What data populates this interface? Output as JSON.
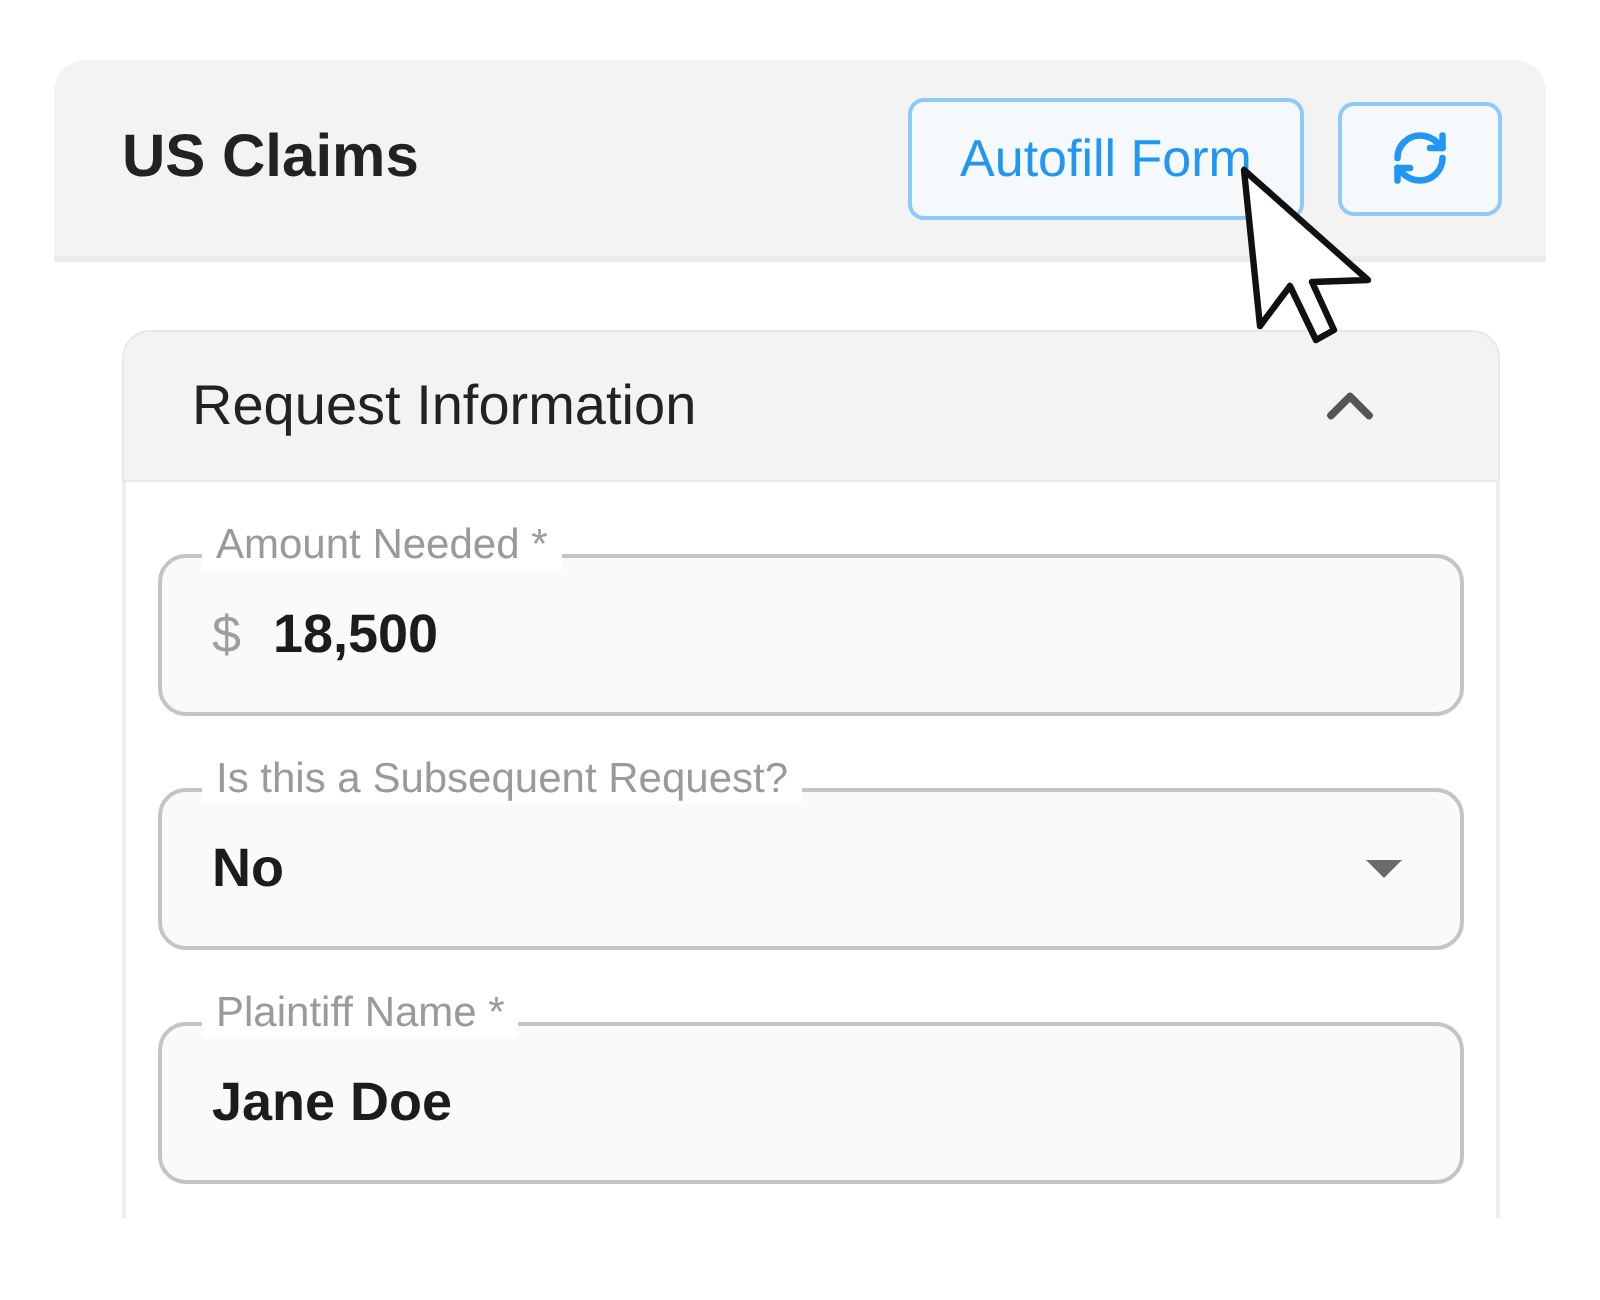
{
  "header": {
    "title": "US Claims",
    "autofill_button": "Autofill Form"
  },
  "section": {
    "title": "Request Information",
    "expanded": true,
    "fields": [
      {
        "kind": "currency",
        "label": "Amount Needed *",
        "prefix": "$",
        "value": "18,500"
      },
      {
        "kind": "select",
        "label": "Is this a Subsequent Request?",
        "value": "No"
      },
      {
        "kind": "text",
        "label": "Plaintiff Name *",
        "value": "Jane Doe"
      }
    ]
  }
}
